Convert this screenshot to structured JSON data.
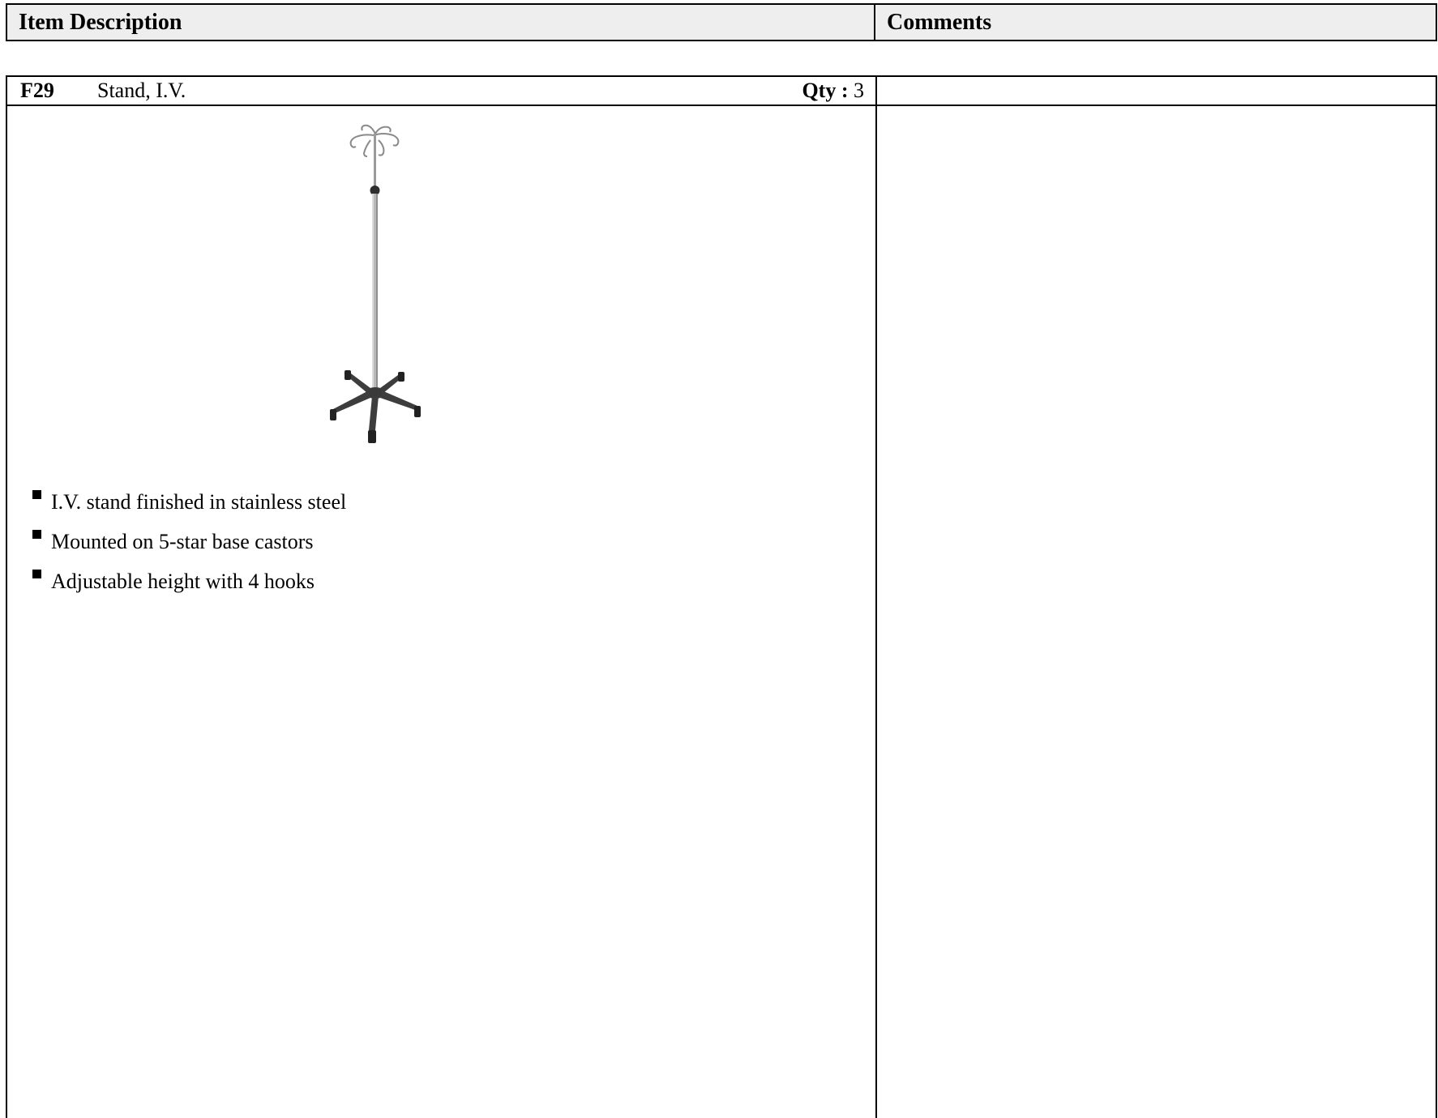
{
  "header": {
    "item_description_label": "Item Description",
    "comments_label": "Comments"
  },
  "item": {
    "code": "F29",
    "name": "Stand, I.V.",
    "qty_label": "Qty :",
    "qty_value": "3",
    "comments": "",
    "image_icon": "iv-stand-image",
    "features": [
      "I.V. stand finished in stainless steel",
      "Mounted on 5-star base castors",
      "Adjustable height with 4 hooks"
    ]
  }
}
